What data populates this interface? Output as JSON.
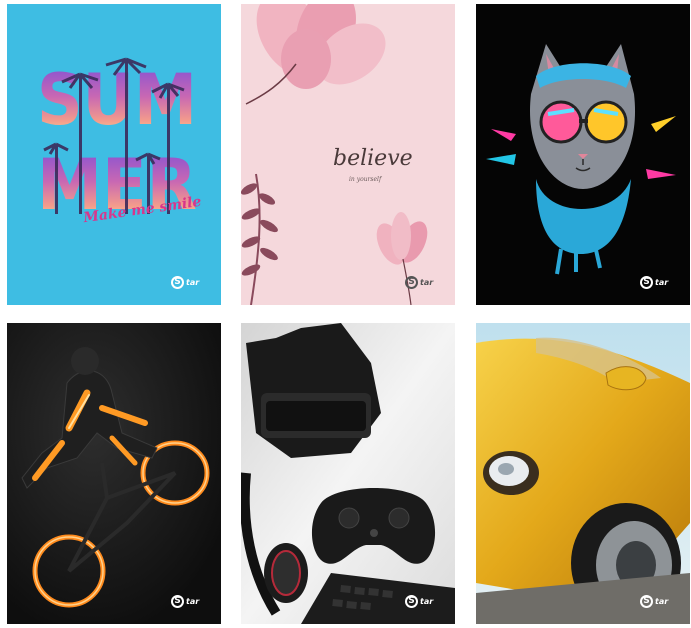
{
  "brand": {
    "logo_mark": "S",
    "logo_word": "tar"
  },
  "covers": [
    {
      "name": "summer",
      "bg": "#3ebde3",
      "title": "SUM MER",
      "tagline": "Make me smile",
      "logo_color": "#ffffff"
    },
    {
      "name": "believe",
      "bg": "#f5d8dc",
      "title": "believe",
      "tagline": "in yourself",
      "logo_color": "#555555"
    },
    {
      "name": "cat",
      "bg": "#050505",
      "logo_color": "#ffffff"
    },
    {
      "name": "bmx",
      "bg": "#141414",
      "logo_color": "#ffffff"
    },
    {
      "name": "gaming",
      "bg": "#e9e9e9",
      "logo_color": "#222222"
    },
    {
      "name": "car",
      "bg": "#e0b41a",
      "logo_color": "#ffffff"
    }
  ],
  "colors": {
    "summer_text_top": "#8a4fd6",
    "summer_text_bottom": "#f6d37a",
    "tagline_pink": "#d8368c",
    "flower_pink": "#e58da5",
    "fern": "#8a4a5c",
    "neon_orange": "#ff8a1c"
  }
}
